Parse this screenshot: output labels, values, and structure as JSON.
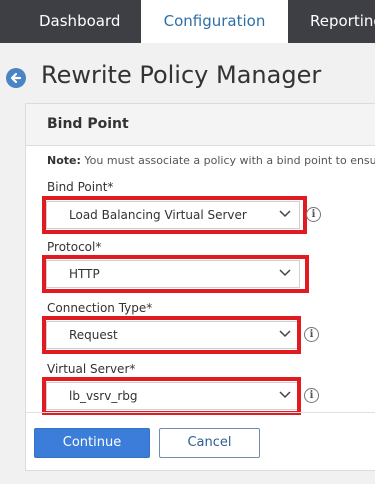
{
  "nav": {
    "tabs": [
      "Dashboard",
      "Configuration",
      "Reporting"
    ],
    "active_tab": "Configuration"
  },
  "page": {
    "title": "Rewrite Policy Manager",
    "back_icon": "back-arrow-icon"
  },
  "panel": {
    "title": "Bind Point",
    "note_label": "Note:",
    "note_text": "You must associate a policy with a bind point to ensure"
  },
  "fields": [
    {
      "label": "Bind Point*",
      "value": "Load Balancing Virtual Server",
      "has_info": true
    },
    {
      "label": "Protocol*",
      "value": "HTTP",
      "has_info": false
    },
    {
      "label": "Connection Type*",
      "value": "Request",
      "has_info": true
    },
    {
      "label": "Virtual Server*",
      "value": "lb_vsrv_rbg",
      "has_info": true
    }
  ],
  "buttons": {
    "continue": "Continue",
    "cancel": "Cancel"
  },
  "colors": {
    "nav_bg": "#3d3f45",
    "highlight": "#e01b22",
    "primary": "#3b7dd8"
  }
}
